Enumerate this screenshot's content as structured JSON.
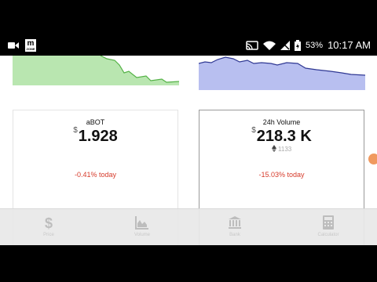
{
  "status_bar": {
    "battery": "53%",
    "time": "10:17 AM",
    "icons": [
      "video-camera-icon",
      "mzone-app-icon",
      "cast-icon",
      "wifi-icon",
      "signal-icon",
      "battery-charging-icon"
    ]
  },
  "app_logo": {
    "letter": "m",
    "sub": "ZONE"
  },
  "colors": {
    "green_chart": "#b9e6b0",
    "green_line": "#54b246",
    "blue_chart": "#b8bff0",
    "blue_line": "#2f3893",
    "negative": "#d63a2a",
    "nav_icon": "#bdbdbd"
  },
  "cards": [
    {
      "title": "aBOT",
      "currency": "$",
      "value": "1.928",
      "subvalue": "",
      "change": "-0.41% today"
    },
    {
      "title": "24h Volume",
      "currency": "$",
      "value": "218.3 K",
      "subvalue": "1133",
      "subvalue_icon": "ethereum-icon",
      "change": "-15.03% today"
    }
  ],
  "bottom_nav": [
    {
      "icon": "dollar-icon",
      "label": "Price"
    },
    {
      "icon": "chart-icon",
      "label": "Volume"
    },
    {
      "icon": "bank-icon",
      "label": "Bank"
    },
    {
      "icon": "calculator-icon",
      "label": "Calculator"
    }
  ]
}
